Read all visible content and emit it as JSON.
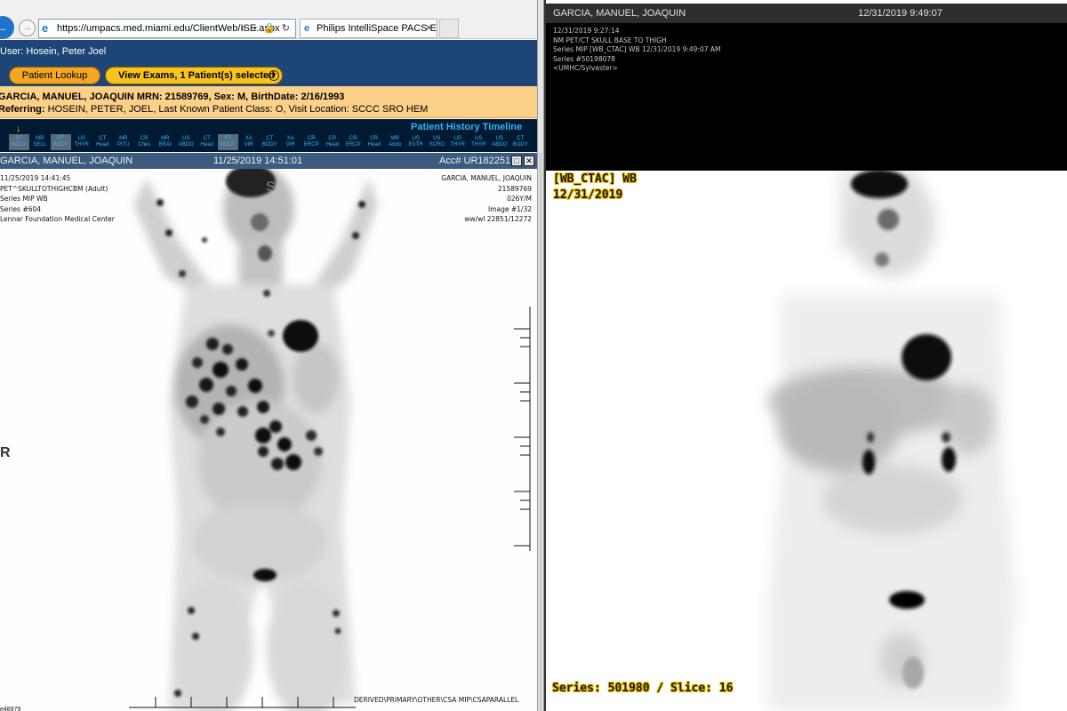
{
  "browser": {
    "url": "https://umpacs.med.miami.edu/ClientWeb/ISE.aspx",
    "tab_title": "Philips IntelliSpace PACS En...",
    "tab_close": "✕",
    "addr_actions": "⌕ ▾ 🔒 ↻"
  },
  "app": {
    "user_line": "User: Hosein, Peter Joel",
    "patient_lookup_label": "Patient Lookup",
    "view_exams_label": "View Exams, 1 Patient(s) selected"
  },
  "patient": {
    "line1": "GARCIA, MANUEL, JOAQUIN  MRN: 21589769, Sex: M, BirthDate: 2/16/1993",
    "line2": "Referring: HOSEIN, PETER, JOEL, Last Known Patient Class: O, Visit Location: SCCC SRO HEM"
  },
  "timeline": {
    "title": "Patient History Timeline",
    "items": [
      {
        "a": "PT",
        "b": "BODY",
        "sel": true
      },
      {
        "a": "MR",
        "b": "SELL",
        "sel": false
      },
      {
        "a": "PT",
        "b": "BODY",
        "sel": true
      },
      {
        "a": "US",
        "b": "THYR",
        "sel": false
      },
      {
        "a": "CT",
        "b": "Head",
        "sel": false
      },
      {
        "a": "MR",
        "b": "PITU",
        "sel": false
      },
      {
        "a": "CR",
        "b": "Ches",
        "sel": false
      },
      {
        "a": "MR",
        "b": "BRAI",
        "sel": false
      },
      {
        "a": "US",
        "b": "ABDO",
        "sel": false
      },
      {
        "a": "CT",
        "b": "Head",
        "sel": false
      },
      {
        "a": "PT",
        "b": "BODY",
        "sel": true
      },
      {
        "a": "XA",
        "b": "VIR",
        "sel": false
      },
      {
        "a": "CT",
        "b": "BODY",
        "sel": false
      },
      {
        "a": "XA",
        "b": "VIR",
        "sel": false
      },
      {
        "a": "CR",
        "b": "ERCP",
        "sel": false
      },
      {
        "a": "CR",
        "b": "Head",
        "sel": false
      },
      {
        "a": "CR",
        "b": "ERCP",
        "sel": false
      },
      {
        "a": "CR",
        "b": "Head",
        "sel": false
      },
      {
        "a": "MR",
        "b": "Abdo",
        "sel": false
      },
      {
        "a": "US",
        "b": "EXTR",
        "sel": false
      },
      {
        "a": "US",
        "b": "SCRO",
        "sel": false
      },
      {
        "a": "US",
        "b": "THYR",
        "sel": false
      },
      {
        "a": "US",
        "b": "THYR",
        "sel": false
      },
      {
        "a": "US",
        "b": "ABDO",
        "sel": false
      },
      {
        "a": "CT",
        "b": "BODY",
        "sel": false
      },
      {
        "a": "CT",
        "b": "CH",
        "sel": false
      }
    ]
  },
  "left_viewer": {
    "header_name": "GARCIA, MANUEL, JOAQUIN",
    "header_date": "11/25/2019  14:51:01",
    "header_acc": "Acc# UR1822517",
    "overlay_left": [
      "11/25/2019 14:41:45",
      "PET^SKULLTOTHIGHCBM (Adult)",
      "Series MIP WB",
      "Series #604",
      "Lennar Foundation Medical Center"
    ],
    "overlay_right": [
      "GARCIA, MANUEL, JOAQUIN",
      "21589769",
      "026Y/M",
      "Image #1/32",
      "ww/wl 22851/12272"
    ],
    "orient_top": "S",
    "orient_left": "R",
    "derived": "DERIVED\\PRIMARY\\OTHER\\CSA MIP\\CSAPARALLEL",
    "bottom_left": "e48979"
  },
  "right_viewer": {
    "header_name": "GARCIA, MANUEL, JOAQUIN",
    "header_date": "12/31/2019  9:49:07",
    "info_lines": [
      "12/31/2019 9:27:14",
      "NM PET/CT SKULL BASE TO THIGH",
      "Series MIP [WB_CTAC] WB 12/31/2019 9:49:07 AM",
      "Series #50198078",
      "<UMHC/Sylvester>"
    ],
    "series_name": "[WB_CTAC] WB",
    "series_date": "12/31/2019",
    "series_slice": "Series: 501980 / Slice: 16"
  }
}
